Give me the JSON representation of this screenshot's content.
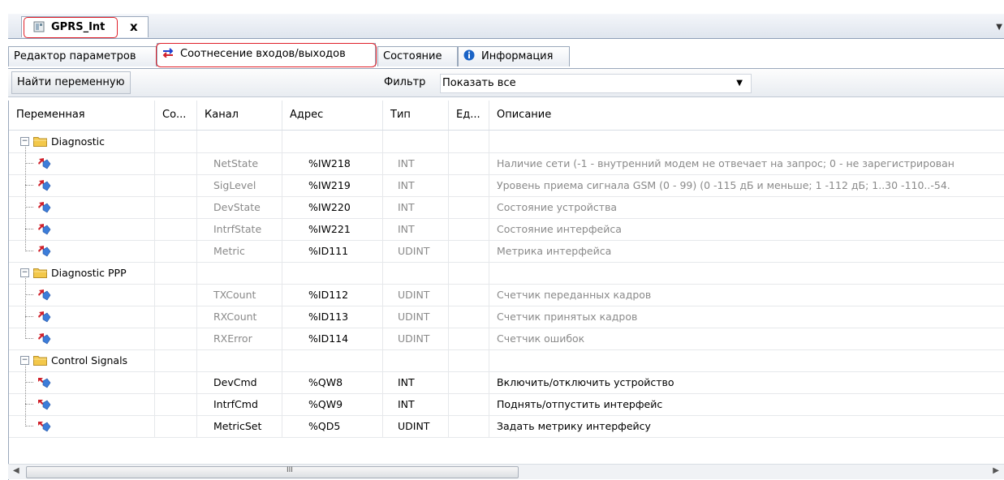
{
  "document_tab": {
    "title": "GPRS_Int",
    "close": "x"
  },
  "sub_tabs": [
    {
      "label": "Редактор параметров"
    },
    {
      "label": "Соотнесение входов/выходов"
    },
    {
      "label": "Состояние"
    },
    {
      "label": "Информация"
    }
  ],
  "toolbar": {
    "find_label": "Найти переменную",
    "filter_label": "Фильтр",
    "filter_value": "Показать все"
  },
  "columns": {
    "variable": "Переменная",
    "mapping": "Со...",
    "channel": "Канал",
    "address": "Адрес",
    "type": "Тип",
    "unit": "Ед...",
    "description": "Описание"
  },
  "groups": [
    {
      "name": "Diagnostic",
      "rows": [
        {
          "channel": "NetState",
          "address": "%IW218",
          "type": "INT",
          "description": "Наличие сети (-1 - внутренний модем не отвечает на запрос; 0 - не зарегистрирован"
        },
        {
          "channel": "SigLevel",
          "address": "%IW219",
          "type": "INT",
          "description": "Уровень приема сигнала GSM (0 - 99) (0 -115 дБ и меньше; 1 -112 дБ; 1..30 -110..-54."
        },
        {
          "channel": "DevState",
          "address": "%IW220",
          "type": "INT",
          "description": "Состояние устройства"
        },
        {
          "channel": "IntrfState",
          "address": "%IW221",
          "type": "INT",
          "description": "Состояние интерфейса"
        },
        {
          "channel": "Metric",
          "address": "%ID111",
          "type": "UDINT",
          "description": "Метрика интерфейса"
        }
      ]
    },
    {
      "name": "Diagnostic PPP",
      "rows": [
        {
          "channel": "TXCount",
          "address": "%ID112",
          "type": "UDINT",
          "description": "Счетчик переданных кадров"
        },
        {
          "channel": "RXCount",
          "address": "%ID113",
          "type": "UDINT",
          "description": "Счетчик принятых кадров"
        },
        {
          "channel": "RXError",
          "address": "%ID114",
          "type": "UDINT",
          "description": "Счетчик ошибок"
        }
      ]
    },
    {
      "name": "Control Signals",
      "rows": [
        {
          "channel": "DevCmd",
          "address": "%QW8",
          "type": "INT",
          "description": "Включить/отключить устройство"
        },
        {
          "channel": "IntrfCmd",
          "address": "%QW9",
          "type": "INT",
          "description": "Поднять/отпустить интерфейс"
        },
        {
          "channel": "MetricSet",
          "address": "%QD5",
          "type": "UDINT",
          "description": "Задать метрику интерфейсу"
        }
      ]
    }
  ],
  "scrollbar": {
    "grip": "III"
  },
  "colors": {
    "highlight_frame": "#e0202a",
    "readonly_text": "#8a8a8a",
    "folder": "#f3c84a"
  }
}
